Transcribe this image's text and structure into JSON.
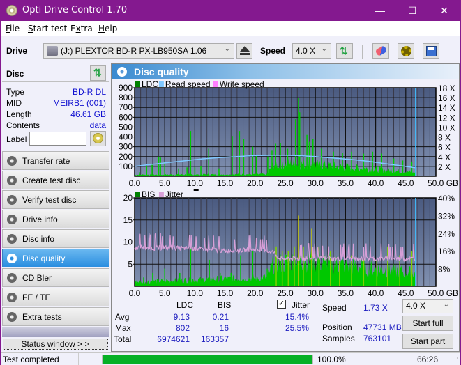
{
  "window": {
    "title": "Opti Drive Control 1.70",
    "minimize": "—",
    "maximize": "☐",
    "close": "✕"
  },
  "menu": [
    {
      "label": "File",
      "accel": "F",
      "rest": "ile"
    },
    {
      "label": "Start test",
      "accel": "S",
      "rest": "tart test"
    },
    {
      "label": "Extra",
      "accel": "x",
      "pre": "E",
      "rest": "tra"
    },
    {
      "label": "Help",
      "accel": "H",
      "rest": "elp"
    }
  ],
  "toolbar": {
    "drive_label": "Drive",
    "drive_value": "(J:)  PLEXTOR BD-R  PX-LB950SA 1.06",
    "speed_label": "Speed",
    "speed_value": "4.0 X"
  },
  "disc": {
    "header": "Disc",
    "rows": [
      {
        "label": "Type",
        "value": "BD-R DL"
      },
      {
        "label": "MID",
        "value": "MEIRB1 (001)"
      },
      {
        "label": "Length",
        "value": "46.61 GB"
      },
      {
        "label": "Contents",
        "value": "data"
      }
    ],
    "label_field_label": "Label",
    "label_field_value": ""
  },
  "nav": [
    {
      "label": "Transfer rate",
      "active": false
    },
    {
      "label": "Create test disc",
      "active": false
    },
    {
      "label": "Verify test disc",
      "active": false
    },
    {
      "label": "Drive info",
      "active": false
    },
    {
      "label": "Disc info",
      "active": false
    },
    {
      "label": "Disc quality",
      "active": true
    },
    {
      "label": "CD Bler",
      "active": false
    },
    {
      "label": "FE / TE",
      "active": false
    },
    {
      "label": "Extra tests",
      "active": false
    }
  ],
  "status_window_btn": "Status window > >",
  "panel": {
    "title": "Disc quality"
  },
  "chart_data": [
    {
      "type": "bar",
      "title": "LDC / Read speed",
      "legend": [
        {
          "name": "LDC",
          "color": "#008000"
        },
        {
          "name": "Read speed",
          "color": "#80c8ff"
        },
        {
          "name": "Write speed",
          "color": "#ff80ff"
        }
      ],
      "xlabel": "GB",
      "xlim": [
        0,
        50
      ],
      "x_ticks": [
        "0.0",
        "5.0",
        "10.0",
        "15.0",
        "20.0",
        "25.0",
        "30.0",
        "35.0",
        "40.0",
        "45.0",
        "50.0 GB"
      ],
      "ylim": [
        0,
        900
      ],
      "y_ticks": [
        "900",
        "800",
        "700",
        "600",
        "500",
        "400",
        "300",
        "200",
        "100"
      ],
      "y2lim": [
        0,
        18
      ],
      "y2_ticks": [
        "18 X",
        "16 X",
        "14 X",
        "12 X",
        "10 X",
        "8 X",
        "6 X",
        "4 X",
        "2 X"
      ],
      "end_marker_gb": 46.61,
      "series": [
        {
          "name": "LDC",
          "color": "#00c800",
          "spikes": [
            [
              0.8,
              40
            ],
            [
              2.0,
              100
            ],
            [
              2.9,
              120
            ],
            [
              4.0,
              200
            ],
            [
              4.3,
              190
            ],
            [
              5.0,
              150
            ],
            [
              7.3,
              80
            ],
            [
              8.7,
              90
            ],
            [
              9.3,
              460
            ],
            [
              10.0,
              90
            ],
            [
              11.0,
              100
            ],
            [
              12.3,
              280
            ],
            [
              14.0,
              80
            ],
            [
              16.2,
              410
            ],
            [
              17.4,
              460
            ],
            [
              18.1,
              380
            ],
            [
              19.6,
              300
            ],
            [
              20.2,
              220
            ],
            [
              22.1,
              200
            ],
            [
              22.8,
              260
            ],
            [
              23.4,
              330
            ],
            [
              24.2,
              340
            ],
            [
              25.4,
              280
            ],
            [
              26.7,
              580
            ],
            [
              27.2,
              800
            ],
            [
              27.4,
              650
            ],
            [
              28.6,
              420
            ],
            [
              29.0,
              350
            ],
            [
              29.6,
              380
            ],
            [
              31.0,
              280
            ],
            [
              33.0,
              250
            ],
            [
              34.5,
              240
            ],
            [
              36.0,
              250
            ],
            [
              38.0,
              230
            ],
            [
              39.5,
              250
            ],
            [
              41.0,
              230
            ],
            [
              43.0,
              180
            ],
            [
              44.5,
              160
            ],
            [
              46.0,
              150
            ]
          ],
          "baseline": [
            [
              0,
              15
            ],
            [
              22,
              20
            ],
            [
              23,
              120
            ],
            [
              26,
              130
            ],
            [
              30,
              120
            ],
            [
              36,
              90
            ],
            [
              40,
              70
            ],
            [
              46.6,
              40
            ]
          ]
        },
        {
          "name": "Read speed",
          "color": "#80c8ff",
          "points": [
            [
              0,
              2.0
            ],
            [
              2,
              2.3
            ],
            [
              5,
              2.7
            ],
            [
              8,
              3.1
            ],
            [
              11,
              3.5
            ],
            [
              14,
              3.8
            ],
            [
              17,
              4.0
            ],
            [
              20,
              4.2
            ],
            [
              23,
              4.3
            ],
            [
              25,
              4.3
            ],
            [
              27,
              4.2
            ],
            [
              30,
              4.0
            ],
            [
              33,
              3.7
            ],
            [
              36,
              3.4
            ],
            [
              39,
              3.0
            ],
            [
              42,
              2.5
            ],
            [
              45,
              2.0
            ],
            [
              46.6,
              1.73
            ]
          ]
        }
      ]
    },
    {
      "type": "bar",
      "title": "BIS / Jitter",
      "legend": [
        {
          "name": "BIS",
          "color": "#008000"
        },
        {
          "name": "Jitter",
          "color": "#d8a0d8"
        }
      ],
      "xlabel": "GB",
      "xlim": [
        0,
        50
      ],
      "x_ticks": [
        "0.0",
        "5.0",
        "10.0",
        "15.0",
        "20.0",
        "25.0",
        "30.0",
        "35.0",
        "40.0",
        "45.0",
        "50.0 GB"
      ],
      "ylim": [
        0,
        20
      ],
      "y_ticks": [
        "20",
        "15",
        "10",
        "5"
      ],
      "y2lim": [
        0,
        40
      ],
      "y2_ticks": [
        "40%",
        "32%",
        "24%",
        "16%",
        "8%"
      ],
      "end_marker_gb": 46.61,
      "series": [
        {
          "name": "BIS",
          "color": "#00c800",
          "spikes": [
            [
              1.5,
              2
            ],
            [
              3.0,
              3
            ],
            [
              5.0,
              4
            ],
            [
              7.5,
              3
            ],
            [
              9.3,
              9
            ],
            [
              12.4,
              6
            ],
            [
              14.2,
              3
            ],
            [
              16.0,
              3
            ],
            [
              17.6,
              7
            ],
            [
              19.6,
              8
            ],
            [
              22.0,
              4
            ],
            [
              23.5,
              9
            ],
            [
              24.5,
              8
            ],
            [
              25.5,
              8
            ],
            [
              26.5,
              9
            ],
            [
              27.2,
              16
            ],
            [
              28.0,
              9
            ],
            [
              29.4,
              13
            ],
            [
              30.6,
              9
            ],
            [
              32.5,
              8
            ],
            [
              34.0,
              6
            ],
            [
              36.0,
              7
            ],
            [
              38.0,
              6
            ],
            [
              40.2,
              6
            ],
            [
              42.0,
              9
            ],
            [
              44.0,
              7
            ],
            [
              46.0,
              8
            ]
          ],
          "baseline": [
            [
              0,
              1
            ],
            [
              10,
              1.5
            ],
            [
              22,
              2
            ],
            [
              23,
              5
            ],
            [
              28,
              6
            ],
            [
              34,
              5
            ],
            [
              40,
              4
            ],
            [
              46.6,
              3
            ]
          ]
        },
        {
          "name": "Jitter",
          "color": "#d8a0d8",
          "points": [
            [
              0,
              17
            ],
            [
              1,
              18
            ],
            [
              2,
              17
            ],
            [
              5,
              17.5
            ],
            [
              10,
              17
            ],
            [
              15,
              16
            ],
            [
              20,
              16.5
            ],
            [
              23,
              15.5
            ],
            [
              24,
              12.5
            ],
            [
              26,
              12.5
            ],
            [
              30,
              12.5
            ],
            [
              35,
              12.5
            ],
            [
              40,
              12.5
            ],
            [
              46.6,
              12.5
            ]
          ]
        }
      ]
    }
  ],
  "stats": {
    "col_ldc": "LDC",
    "col_bis": "BIS",
    "jitter_label": "Jitter",
    "jitter_checked": true,
    "rows": [
      {
        "label": "Avg",
        "ldc": "9.13",
        "bis": "0.21",
        "jitter": "15.4%"
      },
      {
        "label": "Max",
        "ldc": "802",
        "bis": "16",
        "jitter": "25.5%"
      },
      {
        "label": "Total",
        "ldc": "6974621",
        "bis": "163357",
        "jitter": ""
      }
    ],
    "speed_label": "Speed",
    "speed_value": "1.73 X",
    "position_label": "Position",
    "position_value": "47731 MB",
    "samples_label": "Samples",
    "samples_value": "763101",
    "speed_select": "4.0 X",
    "start_full": "Start full",
    "start_part": "Start part"
  },
  "statusbar": {
    "text": "Test completed",
    "progress": 100.0,
    "progress_text": "100.0%",
    "time": "66:26"
  }
}
